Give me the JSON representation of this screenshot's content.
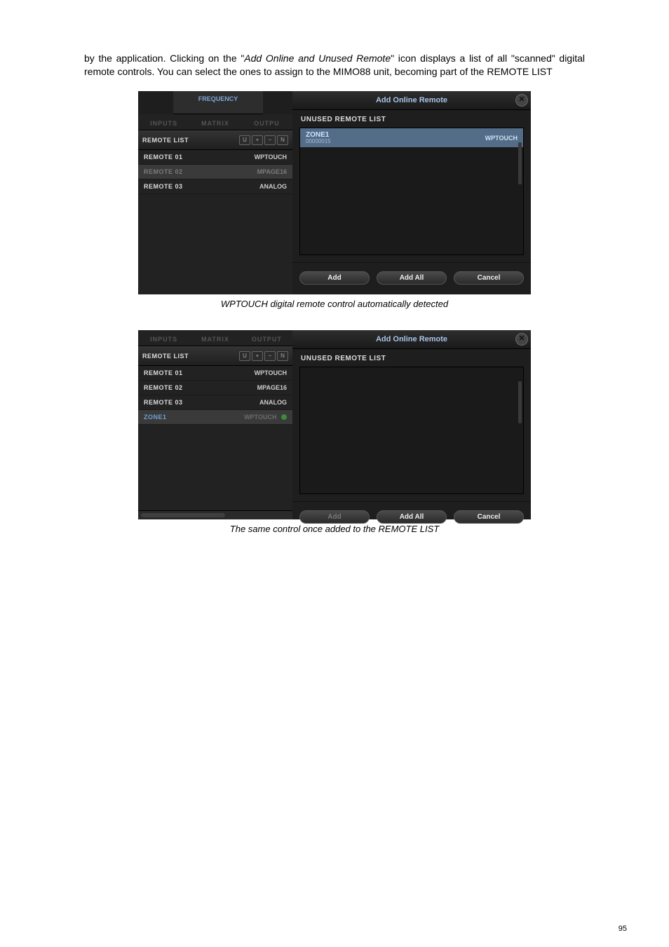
{
  "paragraph": {
    "p1a": "by the application. Clicking on the \"",
    "p1b": "Add Online and Unused Remote",
    "p1c": "\" icon displays a list of all \"scanned\" digital remote controls. You can select the ones to assign to the MIMO88 unit, becoming part of the REMOTE LIST"
  },
  "fig1": {
    "freq_tab": "FREQUENCY",
    "tabs": {
      "inputs": "INPUTS",
      "matrix": "MATRIX",
      "output": "OUTPU"
    },
    "remote_list_title": "REMOTE LIST",
    "icons": {
      "u": "U",
      "plus": "+",
      "minus": "−",
      "n": "N"
    },
    "rows": [
      {
        "name": "REMOTE 01",
        "type": "WPTOUCH"
      },
      {
        "name": "REMOTE 02",
        "type": "MPAGE16",
        "selected": true
      },
      {
        "name": "REMOTE 03",
        "type": "ANALOG"
      }
    ],
    "dialog": {
      "title": "Add Online Remote",
      "list_label": "UNUSED REMOTE LIST",
      "item": {
        "name": "ZONE1",
        "sub": "00000015",
        "type": "WPTOUCH"
      },
      "buttons": {
        "add": "Add",
        "addall": "Add All",
        "cancel": "Cancel"
      }
    },
    "caption": "WPTOUCH digital remote control automatically detected"
  },
  "fig2": {
    "tabs": {
      "inputs": "INPUTS",
      "matrix": "MATRIX",
      "output": "OUTPUT"
    },
    "remote_list_title": "REMOTE LIST",
    "icons": {
      "u": "U",
      "plus": "+",
      "minus": "−",
      "n": "N"
    },
    "rows": [
      {
        "name": "REMOTE 01",
        "type": "WPTOUCH"
      },
      {
        "name": "REMOTE 02",
        "type": "MPAGE16"
      },
      {
        "name": "REMOTE 03",
        "type": "ANALOG"
      },
      {
        "name": "ZONE1",
        "type": "WPTOUCH",
        "zone": true,
        "dot": true
      }
    ],
    "dialog": {
      "title": "Add Online Remote",
      "list_label": "UNUSED REMOTE LIST",
      "buttons": {
        "add": "Add",
        "addall": "Add All",
        "cancel": "Cancel"
      }
    },
    "caption": "The same control once added to the REMOTE LIST"
  },
  "page_number": "95"
}
